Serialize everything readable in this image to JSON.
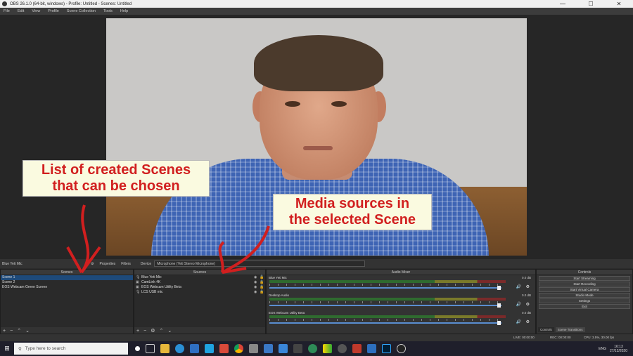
{
  "window": {
    "title": "OBS 26.1.0 (64-bit, windows) - Profile: Untitled - Scenes: Untitled",
    "minimize": "—",
    "maximize": "☐",
    "close": "✕"
  },
  "menu": [
    "File",
    "Edit",
    "View",
    "Profile",
    "Scene Collection",
    "Tools",
    "Help"
  ],
  "annotations": {
    "scenes_callout_line1": "List of created Scenes",
    "scenes_callout_line2": "that can be chosen",
    "sources_callout_line1": "Media sources in",
    "sources_callout_line2": "the selected Scene",
    "arrow_color": "#d11f1f"
  },
  "source_toolbar": {
    "selected_source": "Blue Yeti Mic",
    "properties": "Properties",
    "filters": "Filters",
    "device_label": "Device",
    "device_value": "Microphone (Yeti Stereo Microphone)"
  },
  "scenes": {
    "header": "Scenes",
    "items": [
      "Scene 1",
      "Scene 2",
      "EOS Webcam Green Screen"
    ],
    "selected": "Scene 1"
  },
  "sources": {
    "header": "Sources",
    "items": [
      {
        "label": "Blue Yeti Mic",
        "icon": "mic-icon"
      },
      {
        "label": "CamLink 4K",
        "icon": "camera-icon"
      },
      {
        "label": "EOS Webcam Utility Beta",
        "icon": "camera-icon"
      },
      {
        "label": "LCS USB mic",
        "icon": "mic-icon"
      }
    ]
  },
  "mixer": {
    "header": "Audio Mixer",
    "channels": [
      {
        "name": "Blue Yeti Mic",
        "db": "0.0 dB"
      },
      {
        "name": "Desktop Audio",
        "db": "0.0 dB"
      },
      {
        "name": "EOS Webcam Utility Beta",
        "db": "0.0 dB"
      }
    ]
  },
  "controls": {
    "header": "Controls",
    "buttons": [
      "Start Streaming",
      "Start Recording",
      "Start Virtual Camera",
      "Studio Mode",
      "Settings",
      "Exit"
    ],
    "tabs": [
      "Controls",
      "Scene Transitions"
    ]
  },
  "footer_icons": {
    "add": "+",
    "remove": "−",
    "up": "⌃",
    "down": "⌄"
  },
  "status": {
    "live": "LIVE: 00:00:00",
    "rec": "REC: 00:00:00",
    "cpu": "CPU: 3.5%, 30.00 fps"
  },
  "taskbar": {
    "search_placeholder": "Type here to search",
    "language": "ENG",
    "time": "16:13",
    "date": "27/12/2020"
  },
  "colors": {
    "accent_selected": "#1e4a7a",
    "callout_bg": "#fafae0",
    "callout_text": "#d11f1f"
  }
}
